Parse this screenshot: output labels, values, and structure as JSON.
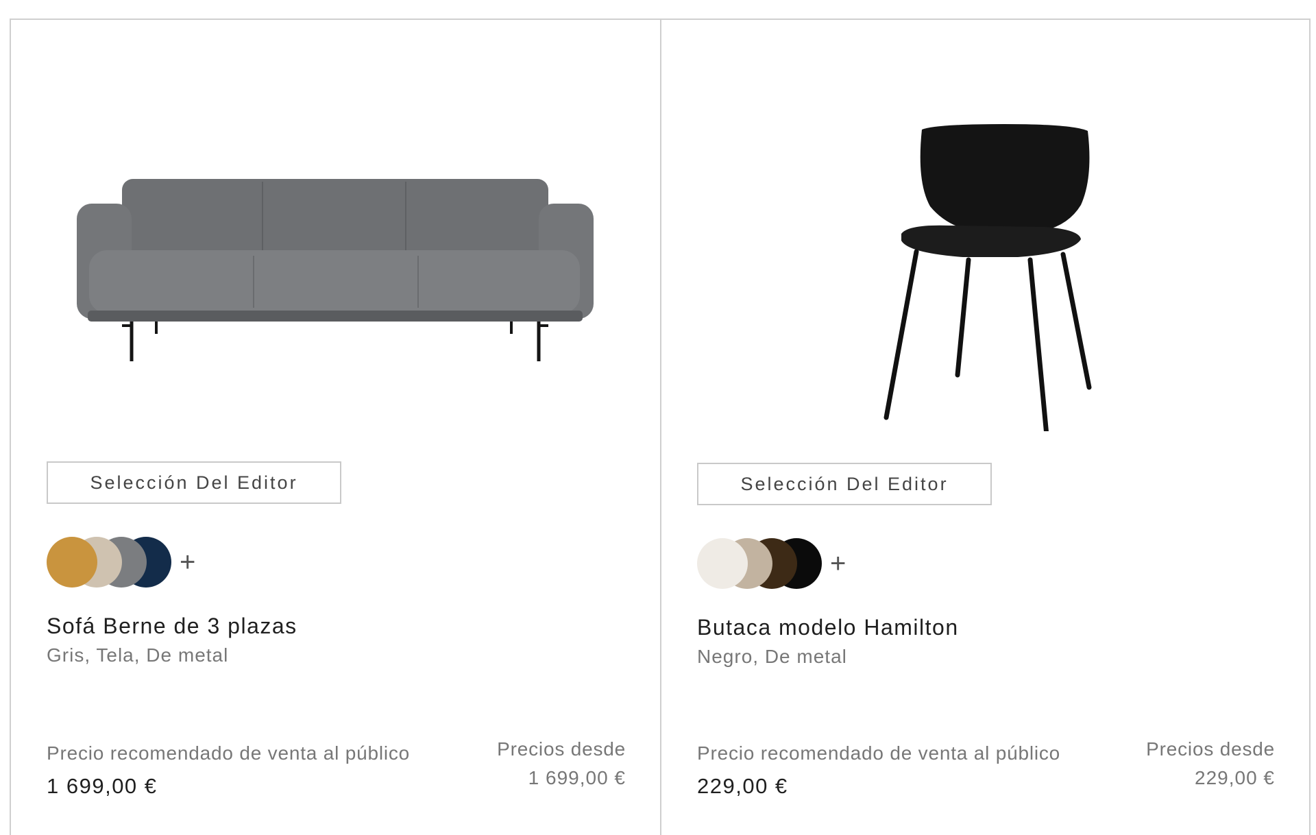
{
  "products": [
    {
      "badge": "Selección Del Editor",
      "swatch_colors": [
        "#c9943e",
        "#cfc2b0",
        "#7b7d80",
        "#132c4a"
      ],
      "more_colors_label": "+",
      "name": "Sofá Berne de 3 plazas",
      "description": "Gris, Tela, De metal",
      "rrp_label": "Precio recomendado de venta al público",
      "price": "1 699,00 €",
      "from_label": "Precios desde",
      "from_price": "1 699,00 €",
      "image_icon": "sofa-image"
    },
    {
      "badge": "Selección Del Editor",
      "swatch_colors": [
        "#efebe5",
        "#c2b3a0",
        "#3d2a16",
        "#0b0b0b"
      ],
      "more_colors_label": "+",
      "name": "Butaca modelo Hamilton",
      "description": "Negro, De metal",
      "rrp_label": "Precio recomendado de venta al público",
      "price": "229,00 €",
      "from_label": "Precios desde",
      "from_price": "229,00 €",
      "image_icon": "chair-image"
    }
  ]
}
